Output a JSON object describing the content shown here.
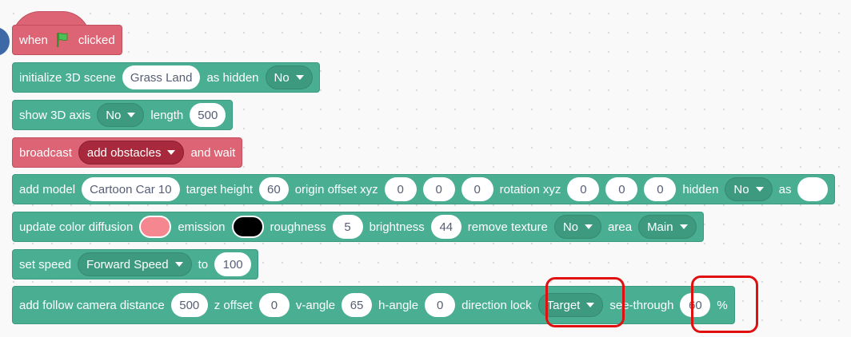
{
  "colors": {
    "green_block": "#4aaf92",
    "red_block": "#dd6474",
    "highlight": "#e01010",
    "diffusion_color": "#f4878f",
    "emission_color": "#000000"
  },
  "hat": {
    "when": "when",
    "icon": "green-flag-icon",
    "clicked": "clicked"
  },
  "init": {
    "label": "initialize 3D scene",
    "scene": "Grass Land",
    "hidden_label": "as hidden",
    "hidden": "No"
  },
  "axis": {
    "label": "show 3D axis",
    "value": "No",
    "length_label": "length",
    "length": "500"
  },
  "broadcast": {
    "label": "broadcast",
    "message": "add obstacles",
    "wait": "and wait"
  },
  "model": {
    "label": "add model",
    "name": "Cartoon Car 10",
    "height_label": "target height",
    "height": "60",
    "offset_label": "origin offset xyz",
    "ox": "0",
    "oy": "0",
    "oz": "0",
    "rot_label": "rotation xyz",
    "rx": "0",
    "ry": "0",
    "rz": "0",
    "hidden_label": "hidden",
    "hidden": "No",
    "as_label": "as",
    "as_value": ""
  },
  "color": {
    "label": "update color diffusion",
    "emission_label": "emission",
    "roughness_label": "roughness",
    "roughness": "5",
    "brightness_label": "brightness",
    "brightness": "44",
    "texture_label": "remove texture",
    "texture": "No",
    "area_label": "area",
    "area": "Main"
  },
  "speed": {
    "label": "set speed",
    "type": "Forward Speed",
    "to_label": "to",
    "value": "100"
  },
  "camera": {
    "label": "add follow camera distance",
    "distance": "500",
    "z_label": "z offset",
    "z": "0",
    "v_label": "v-angle",
    "v": "65",
    "h_label": "h-angle",
    "h": "0",
    "lock_label": "direction lock",
    "lock": "Target",
    "see_label": "see-through",
    "see": "60",
    "pct": "%"
  }
}
